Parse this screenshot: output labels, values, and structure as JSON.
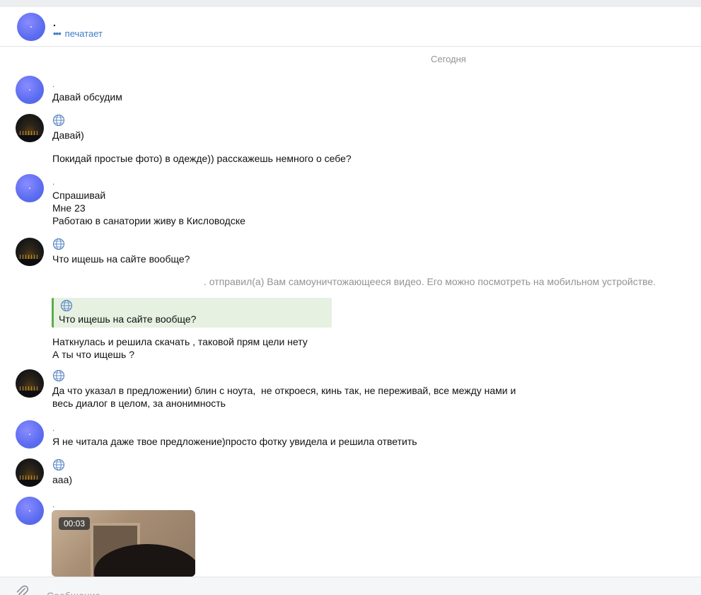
{
  "header": {
    "name": ".",
    "status": "печатает"
  },
  "chat": {
    "date_separator": "Сегодня",
    "messages": [
      {
        "author": ".",
        "text": "Давай обсудим"
      },
      {
        "author": "",
        "text": "Давай)"
      },
      {
        "author": "",
        "text": "Покидай простые фото) в одежде)) расскажешь немного о себе?"
      },
      {
        "author": ".",
        "text": "Спрашивай\nМне 23\nРаботаю в санатории живу в Кисловодске"
      },
      {
        "author": "",
        "text": "Что ищешь на сайте вообще?"
      },
      {
        "author": "",
        "text": "Наткнулась и решила скачать , таковой прям цели нету\nА ты что ищешь ?"
      },
      {
        "author": "",
        "text": "Да что указал в предложении) блин с ноута,  не откроеся, кинь так, не переживай, все между нами и\nвесь диалог в целом, за анонимность"
      },
      {
        "author": ".",
        "text": "Я не читала даже твое предложение)просто фотку увидела и решила ответить"
      },
      {
        "author": "",
        "text": "ааа)"
      },
      {
        "author": ".",
        "text": ""
      }
    ],
    "system_notice": ". отправил(а) Вам самоуничтожающееся видео. Его можно посмотреть на мобильном устройстве.",
    "quote": {
      "text": "Что ищешь на сайте вообще?"
    },
    "video": {
      "duration": "00:03"
    }
  },
  "composer": {
    "placeholder": "Сообщение"
  },
  "colors": {
    "link": "#3f7cc4",
    "quote_bg": "#e6f1e1",
    "quote_border": "#5cad4a",
    "muted": "#939393"
  }
}
